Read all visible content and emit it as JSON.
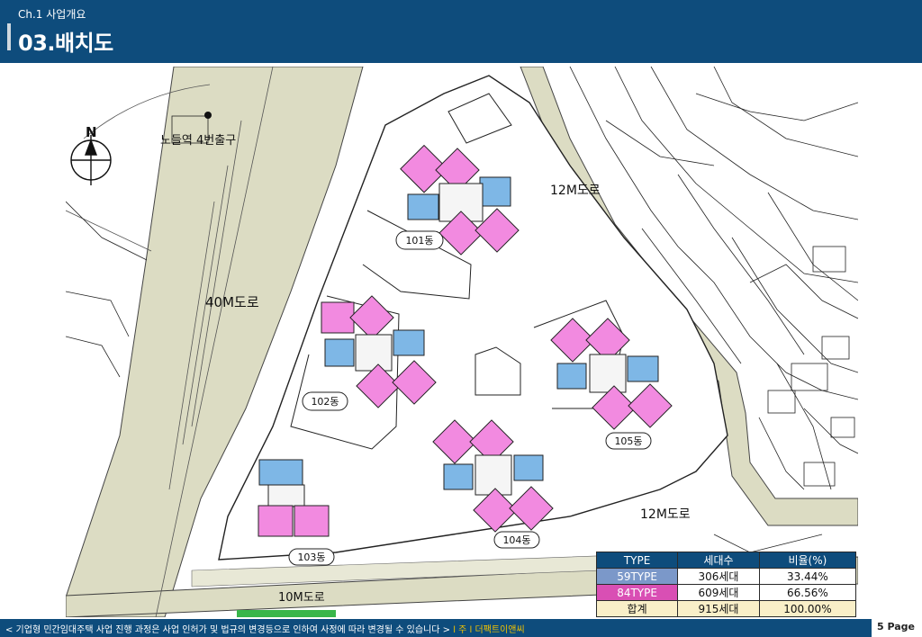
{
  "header": {
    "chapter": "Ch.1 사업개요",
    "title": "03.배치도"
  },
  "map": {
    "place_labels": {
      "exit": "노들역 4번출구",
      "road40": "40M도로",
      "road12a": "12M도로",
      "road12b": "12M도로",
      "road10": "10M도로"
    },
    "buildings": [
      {
        "id": "101",
        "label": "101동"
      },
      {
        "id": "102",
        "label": "102동"
      },
      {
        "id": "103",
        "label": "103동"
      },
      {
        "id": "104",
        "label": "104동"
      },
      {
        "id": "105",
        "label": "105동"
      }
    ],
    "north_label": "N",
    "colors": {
      "type59": "#7eb7e6",
      "type84": "#f28ae0",
      "road": "#dcdcc3",
      "header": "#0e4c7c"
    }
  },
  "table": {
    "headers": [
      "TYPE",
      "세대수",
      "비율(%)"
    ],
    "rows": [
      {
        "type": "59TYPE",
        "units": "306세대",
        "ratio": "33.44%"
      },
      {
        "type": "84TYPE",
        "units": "609세대",
        "ratio": "66.56%"
      },
      {
        "type": "합계",
        "units": "915세대",
        "ratio": "100.00%"
      }
    ]
  },
  "footer": {
    "note": "< 기업형 민간임대주택 사업 진행 과정은 사업 인허가 및 법규의 변경등으로 인하여 사정에 따라 변경될 수 있습니다 >",
    "company": "l 주 l 더팩트이앤씨",
    "page": "5 Page"
  }
}
